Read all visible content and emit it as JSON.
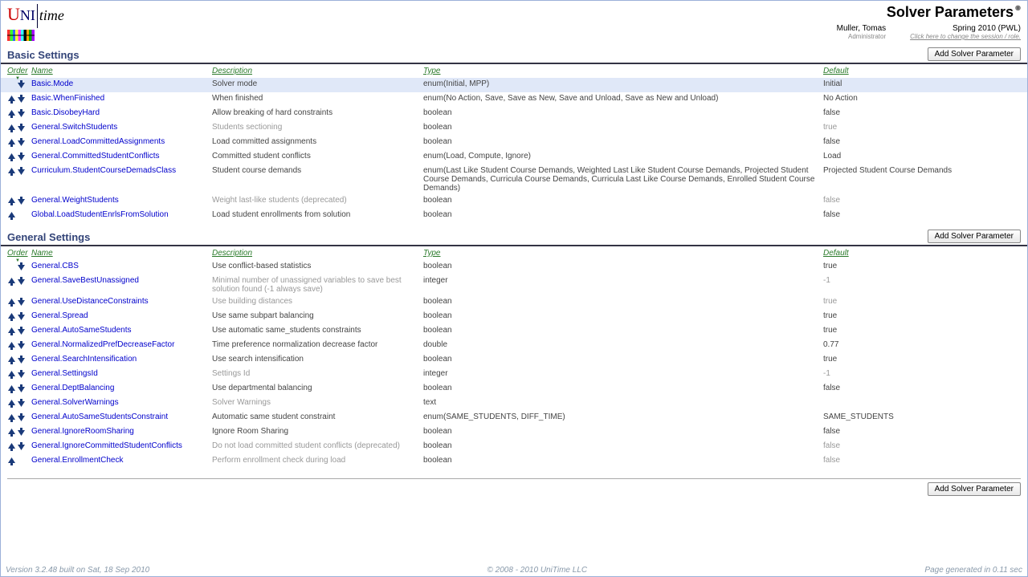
{
  "header": {
    "page_title": "Solver Parameters",
    "user": "Muller, Tomas",
    "role": "Administrator",
    "session": "Spring 2010 (PWL)",
    "session_hint": "Click here to change the session / role."
  },
  "buttons": {
    "add": "Add Solver Parameter"
  },
  "columns": {
    "order": "Order",
    "name": "Name",
    "desc": "Description",
    "type": "Type",
    "default": "Default"
  },
  "sections": [
    {
      "title": "Basic Settings",
      "rows": [
        {
          "up": false,
          "down": true,
          "highlight": true,
          "name": "Basic.Mode",
          "desc": "Solver mode",
          "type": "enum(Initial, MPP)",
          "default": "Initial"
        },
        {
          "up": true,
          "down": true,
          "name": "Basic.WhenFinished",
          "desc": "When finished",
          "type": "enum(No Action, Save, Save as New, Save and Unload, Save as New and Unload)",
          "default": "No Action"
        },
        {
          "up": true,
          "down": true,
          "name": "Basic.DisobeyHard",
          "desc": "Allow breaking of hard constraints",
          "type": "boolean",
          "default": "false"
        },
        {
          "up": true,
          "down": true,
          "muted": true,
          "name": "General.SwitchStudents",
          "desc": "Students sectioning",
          "type": "boolean",
          "default": "true"
        },
        {
          "up": true,
          "down": true,
          "name": "General.LoadCommittedAssignments",
          "desc": "Load committed assignments",
          "type": "boolean",
          "default": "false"
        },
        {
          "up": true,
          "down": true,
          "name": "General.CommittedStudentConflicts",
          "desc": "Committed student conflicts",
          "type": "enum(Load, Compute, Ignore)",
          "default": "Load"
        },
        {
          "up": true,
          "down": true,
          "name": "Curriculum.StudentCourseDemadsClass",
          "desc": "Student course demands",
          "type": "enum(Last Like Student Course Demands, Weighted Last Like Student Course Demands, Projected Student Course Demands, Curricula Course Demands, Curricula Last Like Course Demands, Enrolled Student Course Demands)",
          "default": "Projected Student Course Demands"
        },
        {
          "up": true,
          "down": true,
          "muted": true,
          "name": "General.WeightStudents",
          "desc": "Weight last-like students (deprecated)",
          "type": "boolean",
          "default": "false"
        },
        {
          "up": true,
          "down": false,
          "name": "Global.LoadStudentEnrlsFromSolution",
          "desc": "Load student enrollments from solution",
          "type": "boolean",
          "default": "false"
        }
      ]
    },
    {
      "title": "General Settings",
      "rows": [
        {
          "up": false,
          "down": true,
          "name": "General.CBS",
          "desc": "Use conflict-based statistics",
          "type": "boolean",
          "default": "true"
        },
        {
          "up": true,
          "down": true,
          "muted": true,
          "name": "General.SaveBestUnassigned",
          "desc": "Minimal number of unassigned variables to save best solution found (-1 always save)",
          "type": "integer",
          "default": "-1"
        },
        {
          "up": true,
          "down": true,
          "muted": true,
          "name": "General.UseDistanceConstraints",
          "desc": "Use building distances",
          "type": "boolean",
          "default": "true"
        },
        {
          "up": true,
          "down": true,
          "name": "General.Spread",
          "desc": "Use same subpart balancing",
          "type": "boolean",
          "default": "true"
        },
        {
          "up": true,
          "down": true,
          "name": "General.AutoSameStudents",
          "desc": "Use automatic same_students constraints",
          "type": "boolean",
          "default": "true"
        },
        {
          "up": true,
          "down": true,
          "name": "General.NormalizedPrefDecreaseFactor",
          "desc": "Time preference normalization decrease factor",
          "type": "double",
          "default": "0.77"
        },
        {
          "up": true,
          "down": true,
          "name": "General.SearchIntensification",
          "desc": "Use search intensification",
          "type": "boolean",
          "default": "true"
        },
        {
          "up": true,
          "down": true,
          "muted": true,
          "name": "General.SettingsId",
          "desc": "Settings Id",
          "type": "integer",
          "default": "-1"
        },
        {
          "up": true,
          "down": true,
          "name": "General.DeptBalancing",
          "desc": "Use departmental balancing",
          "type": "boolean",
          "default": "false"
        },
        {
          "up": true,
          "down": true,
          "muted": true,
          "name": "General.SolverWarnings",
          "desc": "Solver Warnings",
          "type": "text",
          "default": ""
        },
        {
          "up": true,
          "down": true,
          "name": "General.AutoSameStudentsConstraint",
          "desc": "Automatic same student constraint",
          "type": "enum(SAME_STUDENTS, DIFF_TIME)",
          "default": "SAME_STUDENTS"
        },
        {
          "up": true,
          "down": true,
          "name": "General.IgnoreRoomSharing",
          "desc": "Ignore Room Sharing",
          "type": "boolean",
          "default": "false"
        },
        {
          "up": true,
          "down": true,
          "muted": true,
          "name": "General.IgnoreCommittedStudentConflicts",
          "desc": "Do not load committed student conflicts (deprecated)",
          "type": "boolean",
          "default": "false"
        },
        {
          "up": true,
          "down": false,
          "muted": true,
          "name": "General.EnrollmentCheck",
          "desc": "Perform enrollment check during load",
          "type": "boolean",
          "default": "false"
        }
      ]
    }
  ],
  "footer": {
    "version": "Version 3.2.48 built on Sat, 18 Sep 2010",
    "copyright": "© 2008 - 2010 UniTime LLC",
    "timing": "Page generated in 0.11 sec"
  }
}
